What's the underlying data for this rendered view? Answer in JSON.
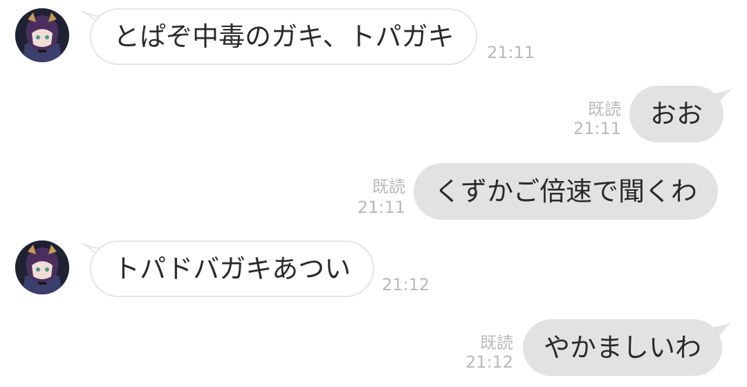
{
  "chat": {
    "messages": [
      {
        "side": "in",
        "text": "とぱぞ中毒のガキ、トパガキ",
        "time": "21:11",
        "avatar_icon": "user-avatar-icon"
      },
      {
        "side": "out",
        "text": "おお",
        "time": "21:11",
        "status": "既読"
      },
      {
        "side": "out",
        "text": "くずかご倍速で聞くわ",
        "time": "21:11",
        "status": "既読"
      },
      {
        "side": "in",
        "text": "トパドバガキあつい",
        "time": "21:12",
        "avatar_icon": "user-avatar-icon"
      },
      {
        "side": "out",
        "text": "やかましいわ",
        "time": "21:12",
        "status": "既読"
      }
    ]
  },
  "colors": {
    "incoming_bubble": "#ffffff",
    "incoming_border": "#e4e4e4",
    "outgoing_bubble": "#e2e2e2",
    "meta_text": "#b8b8b8",
    "message_text": "#2a2a2a"
  }
}
